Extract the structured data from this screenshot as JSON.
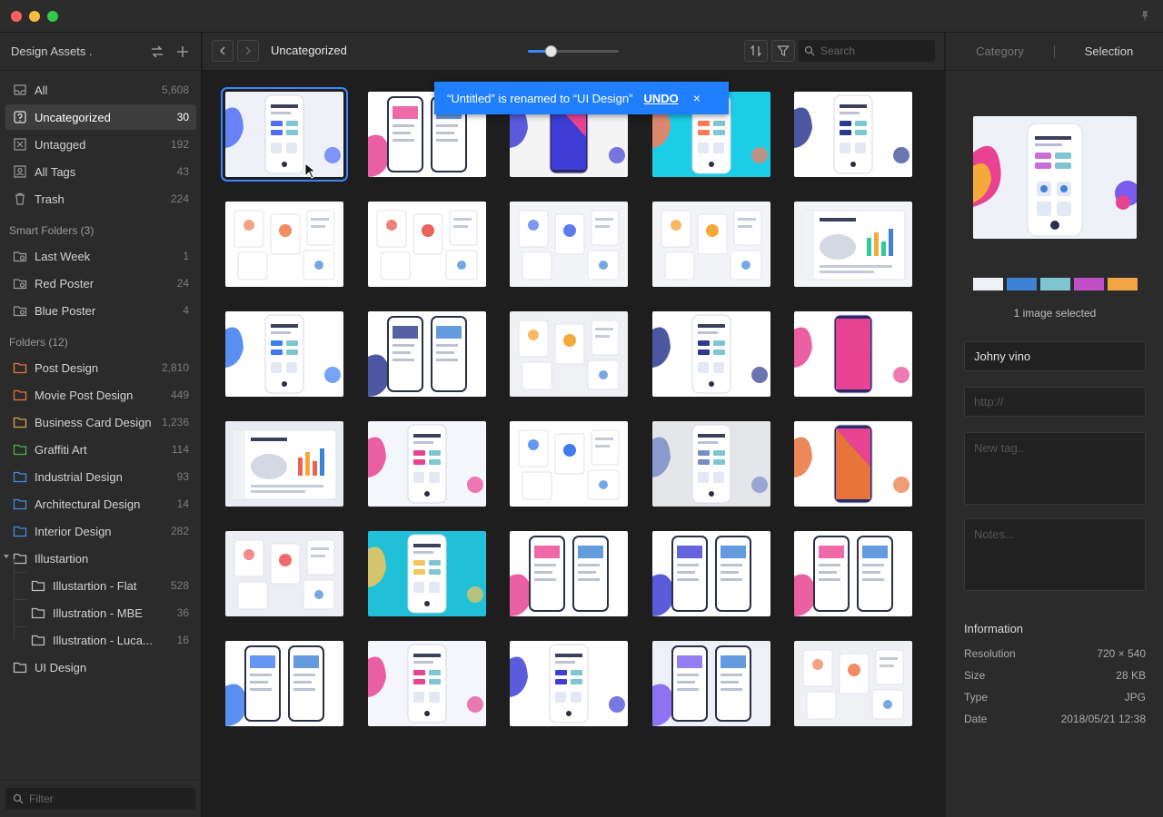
{
  "sidebar": {
    "title": "Design Assets .",
    "library": [
      {
        "label": "All",
        "count": "5,608",
        "icon": "inbox-icon"
      },
      {
        "label": "Uncategorized",
        "count": "30",
        "icon": "question-box-icon"
      },
      {
        "label": "Untagged",
        "count": "192",
        "icon": "untagged-icon"
      },
      {
        "label": "All Tags",
        "count": "43",
        "icon": "tag-icon"
      },
      {
        "label": "Trash",
        "count": "224",
        "icon": "trash-icon"
      }
    ],
    "smart_folders_header": "Smart Folders (3)",
    "smart_folders": [
      {
        "label": "Last Week",
        "count": "1"
      },
      {
        "label": "Red Poster",
        "count": "24"
      },
      {
        "label": "Blue Poster",
        "count": "4"
      }
    ],
    "folders_header": "Folders (12)",
    "folders": [
      {
        "label": "Post Design",
        "count": "2,810",
        "color": "#e8743b"
      },
      {
        "label": "Movie Post Design",
        "count": "449",
        "color": "#e8743b"
      },
      {
        "label": "Business Card Design",
        "count": "1,236",
        "color": "#d9a53a"
      },
      {
        "label": "Graffiti Art",
        "count": "114",
        "color": "#4caf50"
      },
      {
        "label": "Industrial Design",
        "count": "93",
        "color": "#3d8be0"
      },
      {
        "label": "Architectural Design",
        "count": "14",
        "color": "#3d8be0"
      },
      {
        "label": "Interior Design",
        "count": "282",
        "color": "#3d8be0"
      },
      {
        "label": "Illustartion",
        "count": "",
        "color": "#bdbdbd"
      },
      {
        "label": "Illustartion - Flat",
        "count": "528",
        "color": "#bdbdbd"
      },
      {
        "label": "Illustration - MBE",
        "count": "36",
        "color": "#bdbdbd"
      },
      {
        "label": "Illustration - Luca...",
        "count": "16",
        "color": "#bdbdbd"
      },
      {
        "label": "UI Design",
        "count": "",
        "color": "#bdbdbd"
      }
    ],
    "filter_placeholder": "Filter"
  },
  "toolbar": {
    "title": "Uncategorized",
    "zoom": 0.25,
    "search_placeholder": "Search"
  },
  "toast": {
    "message": "“Untitled” is renamed to “UI Design”",
    "action": "UNDO",
    "close": "×"
  },
  "right_panel": {
    "tabs": [
      "Category",
      "Selection"
    ],
    "active_tab": "Selection",
    "palette": [
      "#eef0f8",
      "#3d82d6",
      "#7fc6d2",
      "#c14fc6",
      "#f2a544"
    ],
    "selection_text": "1 image selected",
    "name_value": "Johny vino",
    "url_placeholder": "http://",
    "tag_placeholder": "New tag..",
    "notes_placeholder": "Notes...",
    "info_title": "Information",
    "info": [
      {
        "key": "Resolution",
        "value": "720 × 540"
      },
      {
        "key": "Size",
        "value": "28 KB"
      },
      {
        "key": "Type",
        "value": "JPG"
      },
      {
        "key": "Date",
        "value": "2018/05/21 12:38"
      }
    ]
  },
  "thumbnails": [
    {
      "bg": "#eef1f7",
      "accent": "#4f6ef7",
      "style": "phone",
      "selected": true
    },
    {
      "bg": "#ffffff",
      "accent": "#e84393",
      "style": "phones2"
    },
    {
      "bg": "#f4f4f4",
      "accent": "#3e3ed6",
      "style": "phone-color"
    },
    {
      "bg": "#1ccde8",
      "accent": "#ff7a59",
      "style": "phone"
    },
    {
      "bg": "#ffffff",
      "accent": "#2b3a8f",
      "style": "phone"
    },
    {
      "bg": "#ffffff",
      "accent": "#f28b66",
      "style": "cards"
    },
    {
      "bg": "#ffffff",
      "accent": "#e8635a",
      "style": "cards"
    },
    {
      "bg": "#f3f4f7",
      "accent": "#5b7cf0",
      "style": "cards"
    },
    {
      "bg": "#f3f4f7",
      "accent": "#f6a93b",
      "style": "cards"
    },
    {
      "bg": "#f3f4f7",
      "accent": "#2ecc9a",
      "style": "dashboard"
    },
    {
      "bg": "#ffffff",
      "accent": "#3d7cf0",
      "style": "phone"
    },
    {
      "bg": "#ffffff",
      "accent": "#2b3a8f",
      "style": "phones2"
    },
    {
      "bg": "#eef0f4",
      "accent": "#f6a93b",
      "style": "cards"
    },
    {
      "bg": "#ffffff",
      "accent": "#2b3a8f",
      "style": "phone"
    },
    {
      "bg": "#ffffff",
      "accent": "#e84393",
      "style": "phone-color"
    },
    {
      "bg": "#e9ecf2",
      "accent": "#e8635a",
      "style": "dashboard"
    },
    {
      "bg": "#f5f6fb",
      "accent": "#e84393",
      "style": "phone"
    },
    {
      "bg": "#ffffff",
      "accent": "#3d7cf0",
      "style": "cards"
    },
    {
      "bg": "#e4e6ea",
      "accent": "#7a8cc7",
      "style": "phone"
    },
    {
      "bg": "#ffffff",
      "accent": "#e8743b",
      "style": "phone-color"
    },
    {
      "bg": "#eceef4",
      "accent": "#f26b6b",
      "style": "cards"
    },
    {
      "bg": "#20c0d8",
      "accent": "#f4c55a",
      "style": "phone"
    },
    {
      "bg": "#ffffff",
      "accent": "#e84393",
      "style": "phones2"
    },
    {
      "bg": "#ffffff",
      "accent": "#3d3fd6",
      "style": "phones2"
    },
    {
      "bg": "#ffffff",
      "accent": "#e84393",
      "style": "phones2"
    },
    {
      "bg": "#ffffff",
      "accent": "#3d7cf0",
      "style": "phones2"
    },
    {
      "bg": "#f5f6fb",
      "accent": "#e84393",
      "style": "phone"
    },
    {
      "bg": "#ffffff",
      "accent": "#3d3fd6",
      "style": "phone"
    },
    {
      "bg": "#eef0f8",
      "accent": "#7b5cf0",
      "style": "phones2"
    },
    {
      "bg": "#eef0f4",
      "accent": "#f28b66",
      "style": "cards"
    }
  ]
}
